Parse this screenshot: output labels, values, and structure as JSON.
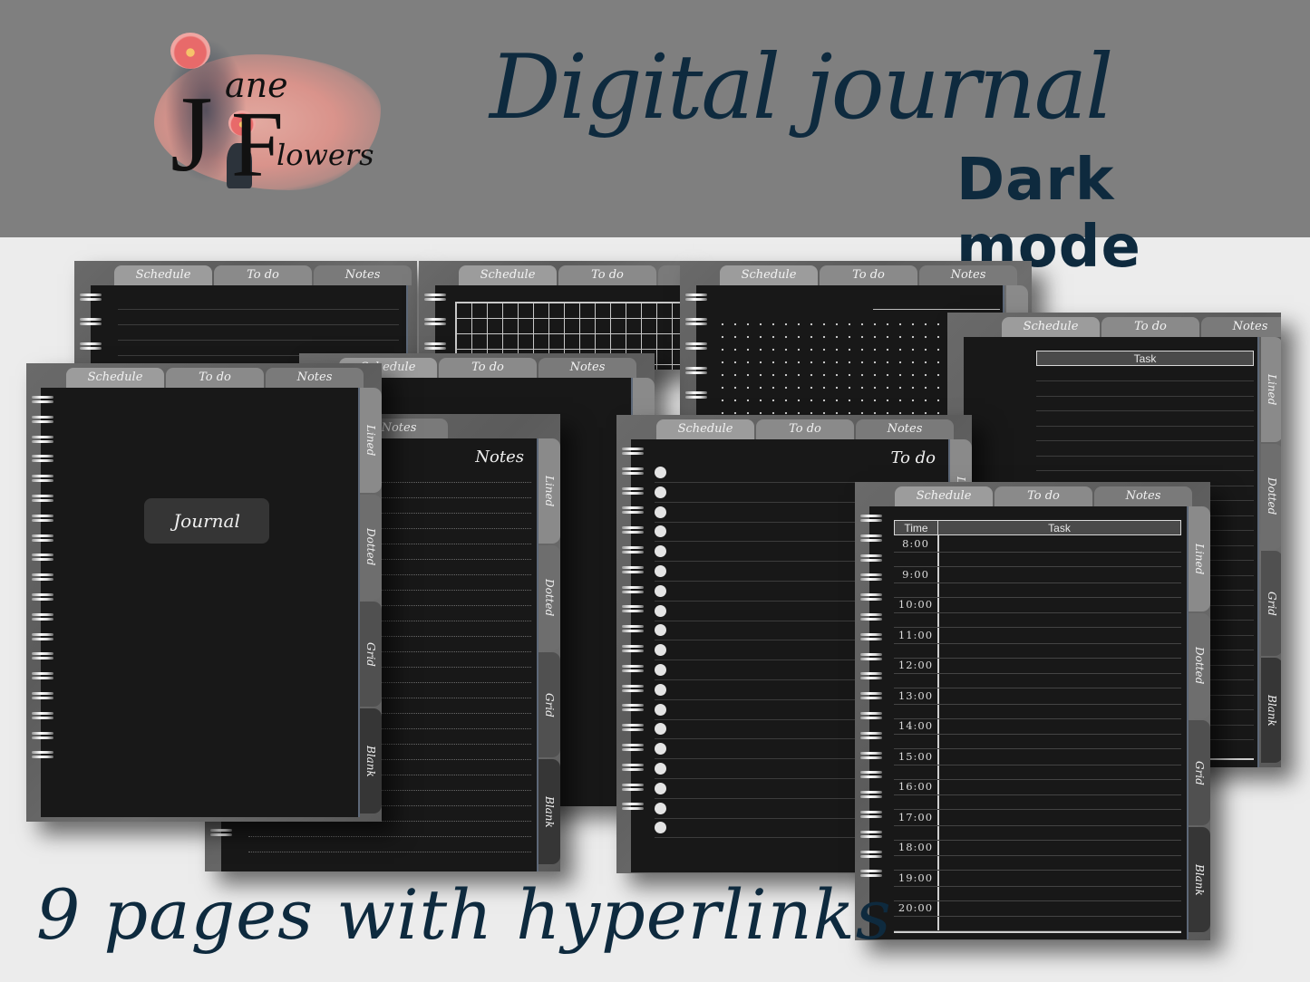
{
  "banner": {
    "title": "Digital journal",
    "subtitle": "Dark mode",
    "background": "#7f7f7f",
    "text_color": "#0e2a3e"
  },
  "logo": {
    "letter_j": "J",
    "letter_f": "F",
    "word_ane": "ane",
    "word_lowers": "lowers",
    "brand": "Jane Flowers"
  },
  "footer": {
    "caption": "9 pages with hyperlinks"
  },
  "journal": {
    "top_tabs": [
      "Schedule",
      "To do",
      "Notes"
    ],
    "side_tabs": [
      "Lined",
      "Dotted",
      "Grid",
      "Blank"
    ],
    "cover_label": "Journal",
    "notes_heading": "Notes",
    "todo_heading": "To do",
    "schedule": {
      "header_time": "Time",
      "header_task": "Task",
      "times": [
        "8:00",
        "9:00",
        "10:00",
        "11:00",
        "12:00",
        "13:00",
        "14:00",
        "15:00",
        "16:00",
        "17:00",
        "18:00",
        "19:00",
        "20:00"
      ]
    },
    "task_page_header": "Task",
    "colors": {
      "sheet": "#181818",
      "frame": "#5f5f5f",
      "tab_light": "#9c9c9c",
      "tab_dark": "#363636"
    }
  }
}
